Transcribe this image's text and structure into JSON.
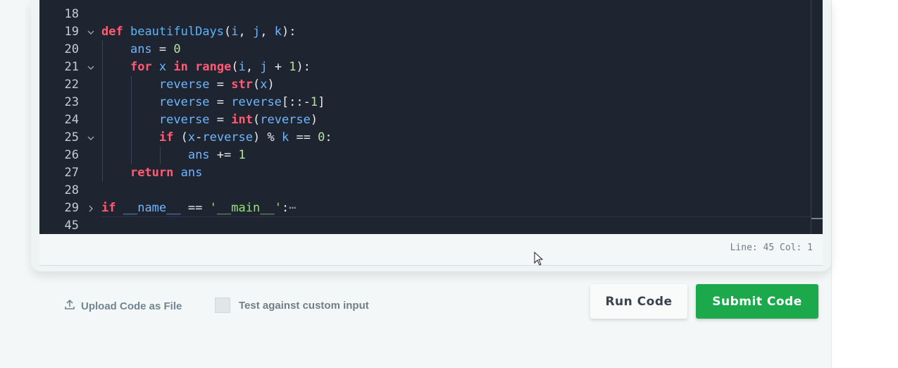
{
  "editor": {
    "lines": [
      {
        "num": "18",
        "fold": "none",
        "tokens": []
      },
      {
        "num": "19",
        "fold": "expanded",
        "tokens": [
          {
            "t": "kw",
            "v": "def"
          },
          {
            "t": "pl",
            "v": " "
          },
          {
            "t": "fn",
            "v": "beautifulDays"
          },
          {
            "t": "pl",
            "v": "("
          },
          {
            "t": "vr",
            "v": "i"
          },
          {
            "t": "pl",
            "v": ", "
          },
          {
            "t": "vr",
            "v": "j"
          },
          {
            "t": "pl",
            "v": ", "
          },
          {
            "t": "vr",
            "v": "k"
          },
          {
            "t": "pl",
            "v": "):"
          }
        ]
      },
      {
        "num": "20",
        "fold": "none",
        "tokens": [
          {
            "t": "pl",
            "v": "    "
          },
          {
            "t": "vr",
            "v": "ans"
          },
          {
            "t": "pl",
            "v": " = "
          },
          {
            "t": "nm",
            "v": "0"
          }
        ]
      },
      {
        "num": "21",
        "fold": "expanded",
        "tokens": [
          {
            "t": "pl",
            "v": "    "
          },
          {
            "t": "kw",
            "v": "for"
          },
          {
            "t": "pl",
            "v": " "
          },
          {
            "t": "vr",
            "v": "x"
          },
          {
            "t": "pl",
            "v": " "
          },
          {
            "t": "kw",
            "v": "in"
          },
          {
            "t": "pl",
            "v": " "
          },
          {
            "t": "kw",
            "v": "range"
          },
          {
            "t": "pl",
            "v": "("
          },
          {
            "t": "vr",
            "v": "i"
          },
          {
            "t": "pl",
            "v": ", "
          },
          {
            "t": "vr",
            "v": "j"
          },
          {
            "t": "pl",
            "v": " + "
          },
          {
            "t": "nm",
            "v": "1"
          },
          {
            "t": "pl",
            "v": "):"
          }
        ]
      },
      {
        "num": "22",
        "fold": "none",
        "tokens": [
          {
            "t": "pl",
            "v": "        "
          },
          {
            "t": "vr",
            "v": "reverse"
          },
          {
            "t": "pl",
            "v": " = "
          },
          {
            "t": "kw",
            "v": "str"
          },
          {
            "t": "pl",
            "v": "("
          },
          {
            "t": "vr",
            "v": "x"
          },
          {
            "t": "pl",
            "v": ")"
          }
        ]
      },
      {
        "num": "23",
        "fold": "none",
        "tokens": [
          {
            "t": "pl",
            "v": "        "
          },
          {
            "t": "vr",
            "v": "reverse"
          },
          {
            "t": "pl",
            "v": " = "
          },
          {
            "t": "vr",
            "v": "reverse"
          },
          {
            "t": "pl",
            "v": "[::-"
          },
          {
            "t": "nm",
            "v": "1"
          },
          {
            "t": "pl",
            "v": "]"
          }
        ]
      },
      {
        "num": "24",
        "fold": "none",
        "tokens": [
          {
            "t": "pl",
            "v": "        "
          },
          {
            "t": "vr",
            "v": "reverse"
          },
          {
            "t": "pl",
            "v": " = "
          },
          {
            "t": "kw",
            "v": "int"
          },
          {
            "t": "pl",
            "v": "("
          },
          {
            "t": "vr",
            "v": "reverse"
          },
          {
            "t": "pl",
            "v": ")"
          }
        ]
      },
      {
        "num": "25",
        "fold": "expanded",
        "tokens": [
          {
            "t": "pl",
            "v": "        "
          },
          {
            "t": "kw",
            "v": "if"
          },
          {
            "t": "pl",
            "v": " ("
          },
          {
            "t": "vr",
            "v": "x"
          },
          {
            "t": "pl",
            "v": "-"
          },
          {
            "t": "vr",
            "v": "reverse"
          },
          {
            "t": "pl",
            "v": ") % "
          },
          {
            "t": "vr",
            "v": "k"
          },
          {
            "t": "pl",
            "v": " == "
          },
          {
            "t": "nm",
            "v": "0"
          },
          {
            "t": "pl",
            "v": ":"
          }
        ]
      },
      {
        "num": "26",
        "fold": "none",
        "tokens": [
          {
            "t": "pl",
            "v": "            "
          },
          {
            "t": "vr",
            "v": "ans"
          },
          {
            "t": "pl",
            "v": " += "
          },
          {
            "t": "nm",
            "v": "1"
          }
        ]
      },
      {
        "num": "27",
        "fold": "none",
        "tokens": [
          {
            "t": "pl",
            "v": "    "
          },
          {
            "t": "kw",
            "v": "return"
          },
          {
            "t": "pl",
            "v": " "
          },
          {
            "t": "vr",
            "v": "ans"
          }
        ]
      },
      {
        "num": "28",
        "fold": "none",
        "tokens": []
      },
      {
        "num": "29",
        "fold": "collapsed",
        "tokens": [
          {
            "t": "kw",
            "v": "if"
          },
          {
            "t": "pl",
            "v": " "
          },
          {
            "t": "vr",
            "v": "__name__"
          },
          {
            "t": "pl",
            "v": " == "
          },
          {
            "t": "st",
            "v": "'__main__'"
          },
          {
            "t": "pl",
            "v": ":"
          },
          {
            "t": "ellip",
            "v": "⋯"
          }
        ]
      },
      {
        "num": "45",
        "fold": "none",
        "tokens": []
      }
    ]
  },
  "status": {
    "position": "Line: 45 Col: 1"
  },
  "actions": {
    "upload_label": "Upload Code as File",
    "custom_input_label": "Test against custom input",
    "custom_input_checked": false,
    "run_label": "Run Code",
    "submit_label": "Submit Code"
  },
  "colors": {
    "accent_green": "#1ba94c",
    "editor_bg": "#1e2430",
    "keyword": "#ff5c73",
    "identifier": "#6eb6ff",
    "number": "#b5e3a1",
    "string": "#98e37a"
  },
  "icons": {
    "upload": "upload-icon",
    "fold_open": "chevron-down-icon",
    "fold_closed": "chevron-right-icon",
    "pointer": "mouse-cursor-icon"
  }
}
